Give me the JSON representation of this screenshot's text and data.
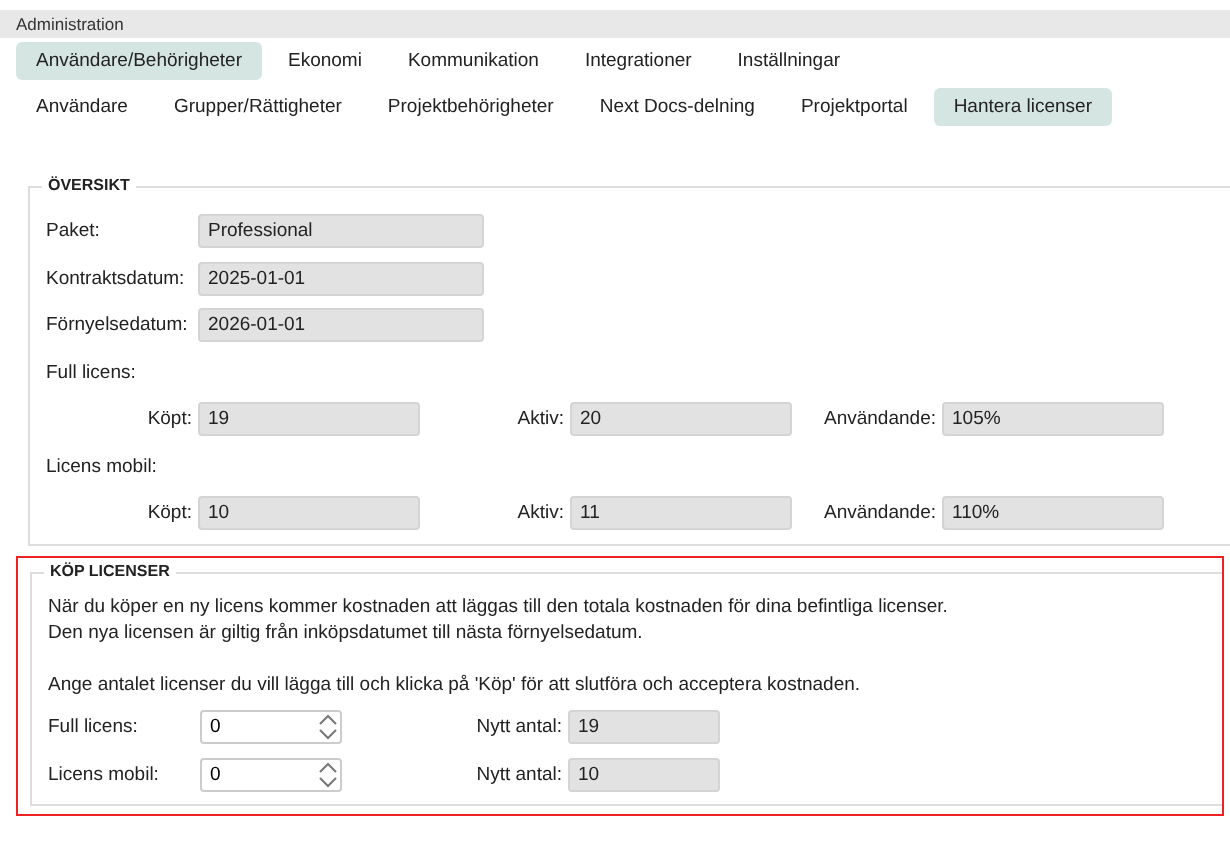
{
  "window": {
    "title": "Administration"
  },
  "main_tabs": [
    {
      "label": "Användare/Behörigheter",
      "selected": true
    },
    {
      "label": "Ekonomi",
      "selected": false
    },
    {
      "label": "Kommunikation",
      "selected": false
    },
    {
      "label": "Integrationer",
      "selected": false
    },
    {
      "label": "Inställningar",
      "selected": false
    }
  ],
  "sub_tabs": [
    {
      "label": "Användare",
      "selected": false
    },
    {
      "label": "Grupper/Rättigheter",
      "selected": false
    },
    {
      "label": "Projektbehörigheter",
      "selected": false
    },
    {
      "label": "Next Docs-delning",
      "selected": false
    },
    {
      "label": "Projektportal",
      "selected": false
    },
    {
      "label": "Hantera licenser",
      "selected": true
    }
  ],
  "overview": {
    "legend": "ÖVERSIKT",
    "fields": [
      {
        "label": "Paket:",
        "value": "Professional"
      },
      {
        "label": "Kontraktsdatum:",
        "value": "2025-01-01"
      },
      {
        "label": "Förnyelsedatum:",
        "value": "2026-01-01"
      }
    ],
    "groups": [
      {
        "title": "Full licens:",
        "fields": [
          {
            "label": "Köpt:",
            "value": "19"
          },
          {
            "label": "Aktiv:",
            "value": "20"
          },
          {
            "label": "Användande:",
            "value": "105%"
          }
        ]
      },
      {
        "title": "Licens mobil:",
        "fields": [
          {
            "label": "Köpt:",
            "value": "10"
          },
          {
            "label": "Aktiv:",
            "value": "11"
          },
          {
            "label": "Användande:",
            "value": "110%"
          }
        ]
      }
    ]
  },
  "purchase": {
    "legend": "KÖP LICENSER",
    "intro": [
      "När du köper en ny licens kommer kostnaden att läggas till den totala kostnaden för dina befintliga licenser.",
      "Den nya licensen är giltig från inköpsdatumet till nästa förnyelsedatum."
    ],
    "instruction": "Ange antalet licenser du vill lägga till och klicka på 'Köp' för att slutföra och acceptera kostnaden.",
    "rows": [
      {
        "label": "Full licens:",
        "value": "0",
        "new_label": "Nytt antal:",
        "new_value": "19"
      },
      {
        "label": "Licens mobil:",
        "value": "0",
        "new_label": "Nytt antal:",
        "new_value": "10"
      }
    ]
  }
}
